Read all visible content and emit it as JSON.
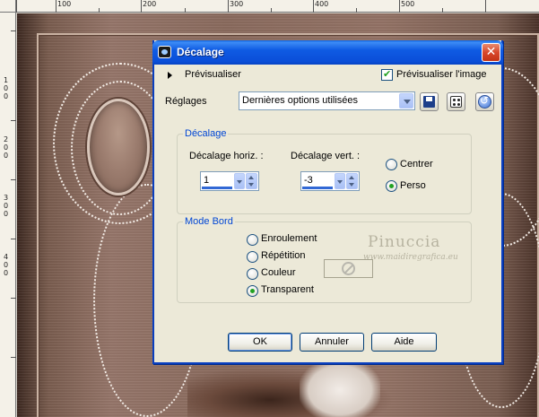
{
  "ruler": {
    "top_labels": [
      "100",
      "200",
      "300",
      "400",
      "500"
    ],
    "left_labels": [
      "1",
      "0",
      "0",
      "2",
      "0",
      "0",
      "3",
      "0",
      "0",
      "4",
      "0",
      "0"
    ]
  },
  "dialog": {
    "title": "Décalage",
    "close_glyph": "✕",
    "preview_label": "Prévisualiser",
    "preview_image_label": "Prévisualiser l'image",
    "preview_image_checked": true,
    "settings_label": "Réglages",
    "settings_value": "Dernières options utilisées",
    "offset_group": {
      "title": "Décalage",
      "horiz_label": "Décalage horiz. :",
      "horiz_value": "1",
      "vert_label": "Décalage vert. :",
      "vert_value": "-3",
      "center_label": "Centrer",
      "custom_label": "Perso",
      "selected": "Perso"
    },
    "edge_group": {
      "title": "Mode Bord",
      "options": [
        "Enroulement",
        "Répétition",
        "Couleur",
        "Transparent"
      ],
      "selected": "Transparent"
    },
    "watermark": {
      "name": "Pinuccia",
      "url": "www.maidiregrafica.eu"
    },
    "buttons": {
      "ok": "OK",
      "cancel": "Annuler",
      "help": "Aide"
    }
  },
  "icons": {
    "app": "app-icon",
    "save": "save-icon",
    "random": "dice-icon",
    "reset": "reset-icon",
    "no_color": "no-color-icon"
  },
  "colors": {
    "titlebar": "#0a4ed8",
    "dialog_bg": "#ece9d8",
    "group_title": "#0046d5",
    "radio_dot": "#21a121",
    "close": "#d8472b"
  }
}
